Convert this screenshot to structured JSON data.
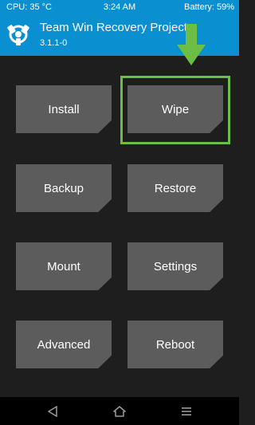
{
  "status": {
    "cpu": "CPU: 35 °C",
    "time": "3:24 AM",
    "battery": "Battery: 59%"
  },
  "header": {
    "title": "Team Win Recovery Project",
    "version": "3.1.1-0",
    "logo_icon": "twrp-logo-icon"
  },
  "tiles": {
    "install": "Install",
    "wipe": "Wipe",
    "backup": "Backup",
    "restore": "Restore",
    "mount": "Mount",
    "settings": "Settings",
    "advanced": "Advanced",
    "reboot": "Reboot"
  },
  "highlight": {
    "target": "Wipe",
    "color": "#6ebd44"
  },
  "nav": {
    "back_icon": "back-triangle-icon",
    "home_icon": "home-icon",
    "menu_icon": "menu-icon"
  },
  "colors": {
    "header": "#0a8fd1",
    "background": "#1e1e1e",
    "tile": "#5c5c5c",
    "nav_bar": "#000000"
  }
}
